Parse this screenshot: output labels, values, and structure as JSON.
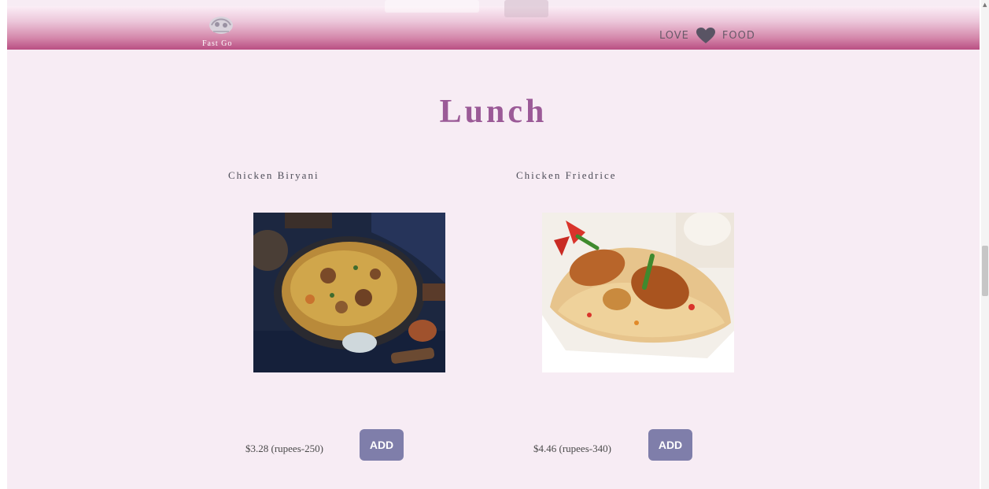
{
  "header": {
    "logo_text": "Fast Go",
    "slogan_left": "LOVE",
    "slogan_right": "FOOD",
    "heart_icon": "heart-icon",
    "colors": {
      "bar_dark": "#b94e83",
      "bar_light": "#fbeef6"
    }
  },
  "section": {
    "title": "Lunch",
    "title_color": "#9b5a97",
    "background": "#f7ecf4"
  },
  "items": [
    {
      "name": "Chicken Biryani",
      "price": "$3.28 (rupees-250)",
      "button_label": "ADD"
    },
    {
      "name": "Chicken Friedrice",
      "price": "$4.46 (rupees-340)",
      "button_label": "ADD"
    }
  ],
  "button_color": "#7f7eaa"
}
